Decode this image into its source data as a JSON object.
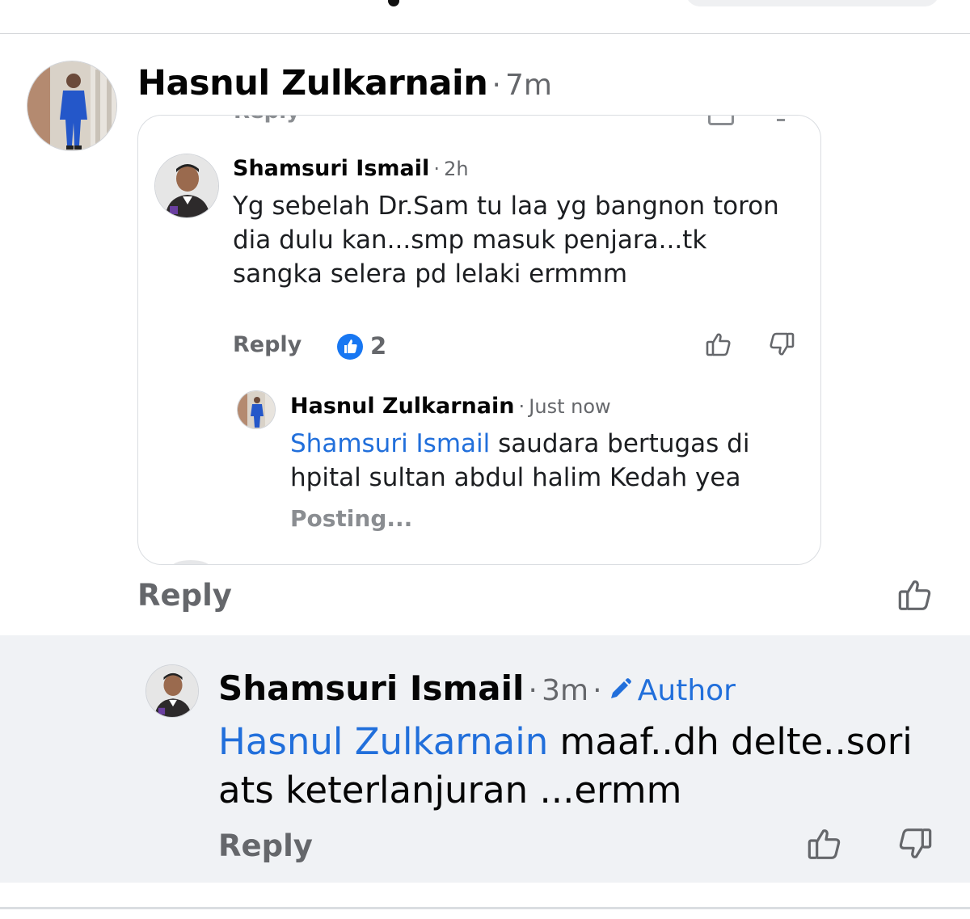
{
  "colors": {
    "link_blue": "#216fdb",
    "reaction_blue": "#1877f2",
    "secondary_text": "#65676b",
    "highlight_bg": "#f0f2f5"
  },
  "comment1": {
    "author": "Hasnul Zulkarnain",
    "separator": "·",
    "time": "7m",
    "reply_label": "Reply"
  },
  "embedded": {
    "cut_top_label": "Reply",
    "shamsuri": {
      "author": "Shamsuri Ismail",
      "separator": "·",
      "time": "2h",
      "text": "Yg sebelah Dr.Sam tu laa yg bangnon toron dia dulu kan...smp masuk penjara...tk sangka selera pd lelaki ermmm",
      "reply_label": "Reply",
      "reaction_icon": "like-reaction-icon",
      "reaction_count": "2"
    },
    "hasnul_reply": {
      "author": "Hasnul Zulkarnain",
      "separator": "·",
      "time": "Just now",
      "mention": "Shamsuri Ismail",
      "text": "saudara bertugas di hpital sultan abdul halim Kedah yea",
      "status": "Posting..."
    }
  },
  "comment2": {
    "author": "Shamsuri Ismail",
    "separator": "·",
    "time": "3m",
    "author_badge": "Author",
    "mention": "Hasnul Zulkarnain",
    "text": "maaf..dh delte..sori ats keterlanjuran ...ermm",
    "reply_label": "Reply"
  }
}
